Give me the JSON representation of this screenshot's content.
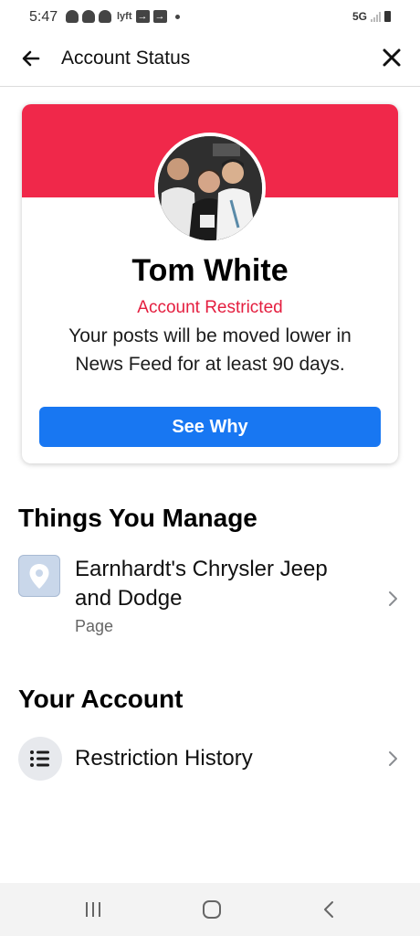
{
  "status_bar": {
    "time": "5:47",
    "lyft": "lyft",
    "box1": "→",
    "box2": "→",
    "network": "5G"
  },
  "header": {
    "title": "Account Status",
    "back_icon": "arrow-left-icon",
    "close_icon": "close-icon"
  },
  "profile": {
    "name": "Tom White",
    "status": "Account Restricted",
    "description": "Your posts will be moved lower in News Feed for at least 90 days.",
    "cta": "See Why"
  },
  "colors": {
    "banner": "#f0284a",
    "restricted_text": "#e41e3f",
    "button": "#1877f2"
  },
  "things_you_manage": {
    "title": "Things You Manage",
    "items": [
      {
        "title": "Earnhardt's Chrysler Jeep and Dodge",
        "subtitle": "Page",
        "icon": "location-pin-icon"
      }
    ]
  },
  "your_account": {
    "title": "Your Account",
    "items": [
      {
        "title": "Restriction History",
        "icon": "list-icon"
      }
    ]
  },
  "nav_bar": {
    "buttons": [
      "recent-apps-icon",
      "home-icon",
      "back-icon"
    ]
  }
}
